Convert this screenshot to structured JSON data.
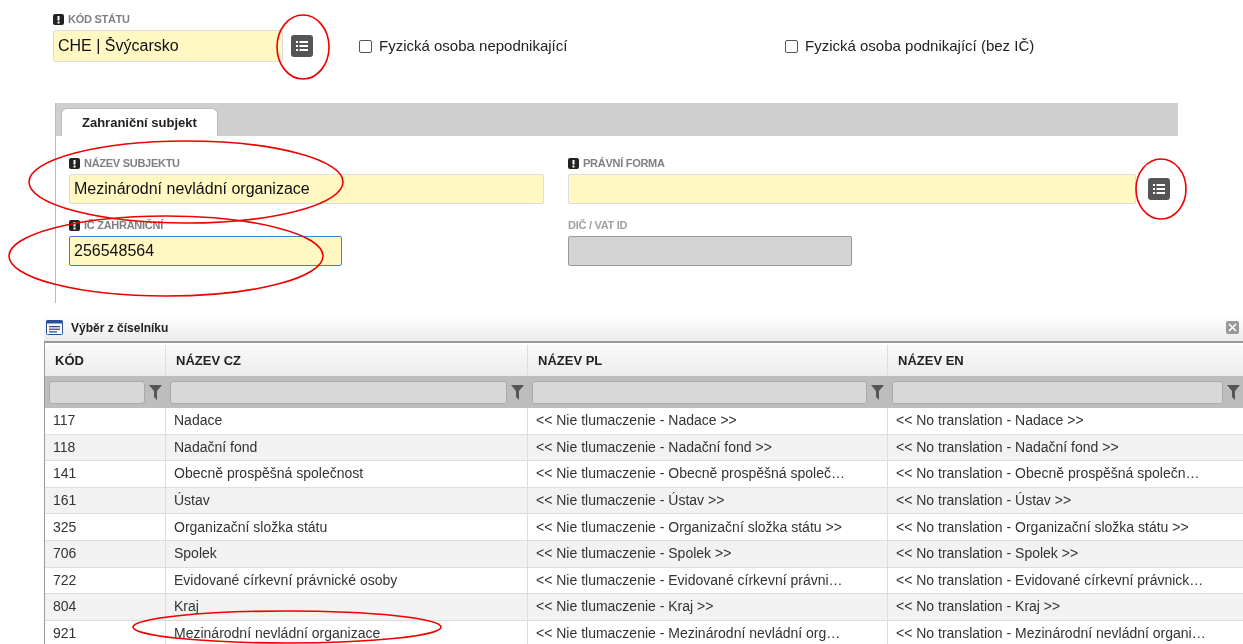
{
  "country": {
    "label": "KÓD STÁTU",
    "required": true,
    "value": "CHE | Švýcarsko"
  },
  "checkboxes": [
    {
      "label": "Fyzická osoba nepodnikající",
      "checked": false
    },
    {
      "label": "Fyzická osoba podnikající (bez IČ)",
      "checked": false
    }
  ],
  "tabs": [
    {
      "label": "Zahraniční subjekt",
      "selected": true
    }
  ],
  "fields": [
    {
      "label": "NÁZEV SUBJEKTU",
      "required": true,
      "value": "Mezinárodní nevládní organizace",
      "focused": false,
      "disabled": false,
      "lookup": false
    },
    {
      "label": "PRÁVNÍ FORMA",
      "required": true,
      "focused": false,
      "disabled": false,
      "lookup": true
    },
    {
      "label": "IČ ZAHRANIČNÍ",
      "required": true,
      "value": "256548564",
      "focused": true,
      "disabled": false,
      "lookup": false
    },
    {
      "label": "DIČ / VAT ID",
      "required": false,
      "focused": false,
      "disabled": true,
      "lookup": false
    }
  ],
  "dialog": {
    "title": "Výběr z číselníku",
    "table": {
      "columns": [
        "KÓD",
        "NÁZEV CZ",
        "NÁZEV PL",
        "NÁZEV EN"
      ],
      "rows": [
        [
          "117",
          "Nadace",
          "<< Nie tlumaczenie - Nadace >>",
          "<< No translation - Nadace >>"
        ],
        [
          "118",
          "Nadační fond",
          "<< Nie tlumaczenie - Nadační fond >>",
          "<< No translation - Nadační fond >>"
        ],
        [
          "141",
          "Obecně prospěšná společnost",
          "<< Nie tlumaczenie - Obecně prospěšná společ…",
          "<< No translation - Obecně prospěšná společn…"
        ],
        [
          "161",
          "Ústav",
          "<< Nie tlumaczenie - Ústav >>",
          "<< No translation - Ústav >>"
        ],
        [
          "325",
          "Organizační složka státu",
          "<< Nie tlumaczenie - Organizační složka státu >>",
          "<< No translation - Organizační složka státu >>"
        ],
        [
          "706",
          "Spolek",
          "<< Nie tlumaczenie - Spolek >>",
          "<< No translation - Spolek >>"
        ],
        [
          "722",
          "Evidované církevní právnické osoby",
          "<< Nie tlumaczenie - Evidované církevní právni…",
          "<< No translation - Evidované církevní právnick…"
        ],
        [
          "804",
          "Kraj",
          "<< Nie tlumaczenie - Kraj >>",
          "<< No translation - Kraj >>"
        ],
        [
          "921",
          "Mezinárodní nevládní organizace",
          "<< Nie tlumaczenie - Mezinárodní nevládní org…",
          "<< No translation - Mezinárodní nevládní organi…"
        ]
      ]
    }
  }
}
